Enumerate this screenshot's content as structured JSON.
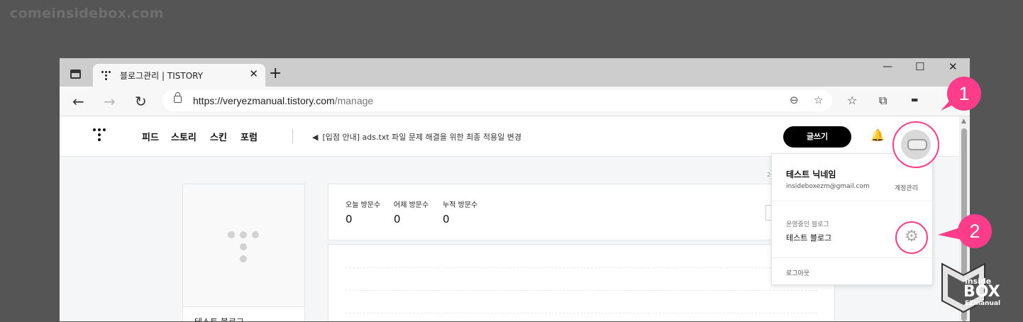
{
  "watermark": "comeinsidebox.com",
  "browser": {
    "tab_title": "블로그관리 | TISTORY",
    "tab_close": "✕",
    "new_tab": "+",
    "minimize": "—",
    "maximize": "☐",
    "close": "✕",
    "url_main": "https://veryezmanual.tistory.com",
    "url_path": "/manage"
  },
  "site": {
    "menu": [
      "피드",
      "스토리",
      "스킨",
      "포럼"
    ],
    "notice": "[입점 안내] ads.txt 파일 문제 해결을 위한 최종 적용일 변경",
    "write_button": "글쓰기",
    "blog_name": "테스트 블로그",
    "date_fragment": "2(",
    "stats": [
      {
        "label": "오늘 방문수",
        "value": "0"
      },
      {
        "label": "어제 방문수",
        "value": "0"
      },
      {
        "label": "누적 방문수",
        "value": "0"
      }
    ]
  },
  "dropdown": {
    "nickname": "테스트 닉네임",
    "email": "insideboxezm@gmail.com",
    "account_link": "계정관리",
    "section_label": "운영중인 블로그",
    "blog_name": "테스트 블로그",
    "logout": "로그아웃"
  },
  "callouts": [
    "1",
    "2"
  ],
  "logo": {
    "line1": "inside",
    "line2": "BOX",
    "line3": "EZmanual"
  },
  "colors": {
    "callout": "#ff3c8a",
    "write_button": "#000000"
  }
}
